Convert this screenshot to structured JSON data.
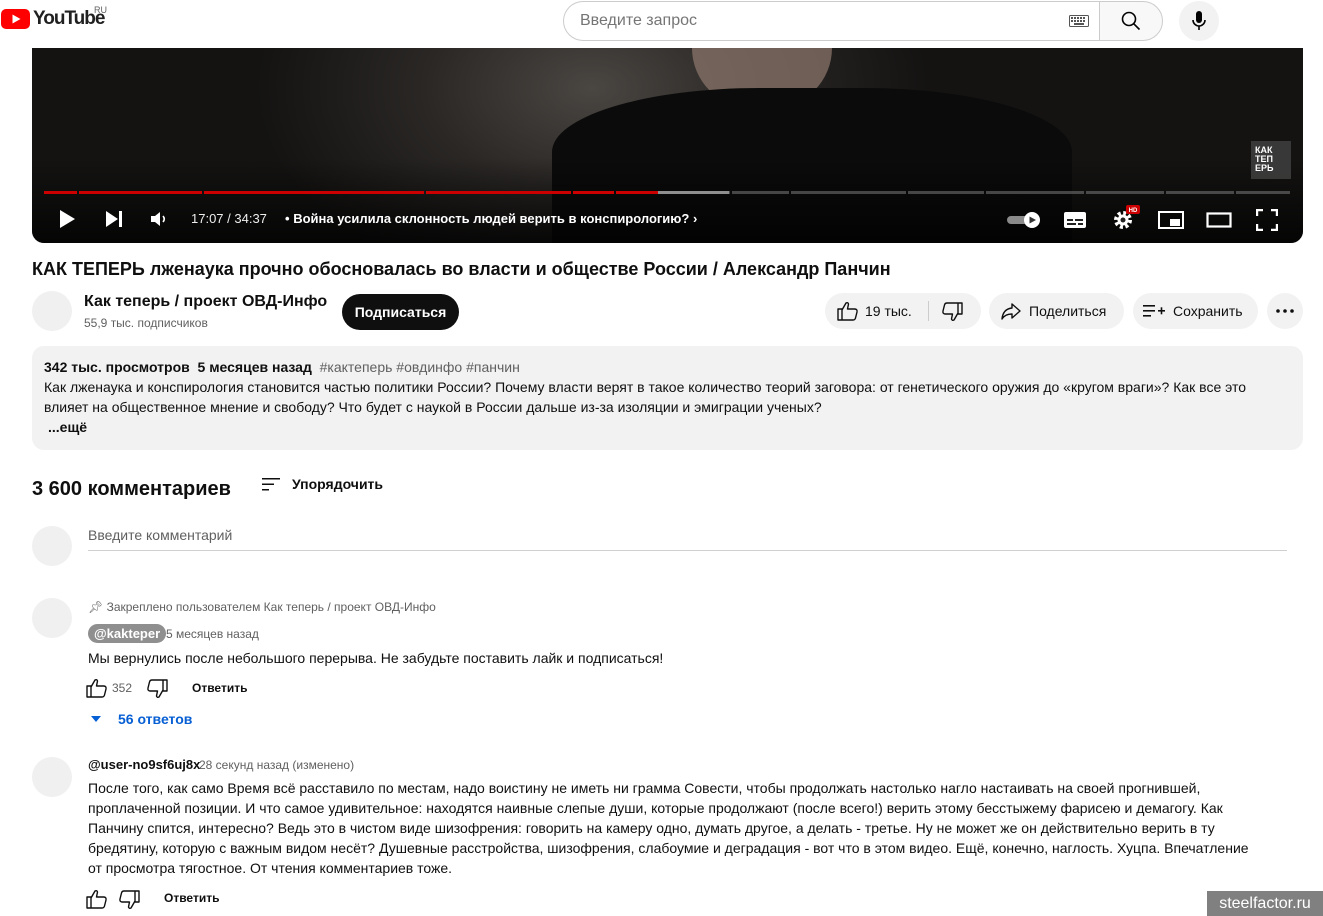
{
  "header": {
    "logo_text": "YouTube",
    "country": "RU",
    "search_placeholder": "Введите запрос"
  },
  "player": {
    "time": "17:07 / 34:37",
    "chapter_separator": "•",
    "chapter": "Война усилила склонность людей верить в конспирологию?",
    "watermark": [
      "КАК",
      "ТЕП",
      "ЕРЬ"
    ],
    "progress_played": 0.493,
    "progress_buffered": 0.55
  },
  "video": {
    "title": "КАК ТЕПЕРЬ лженаука прочно обосновалась во власти и обществе России / Александр Панчин",
    "channel_name": "Как теперь / проект ОВД-Инфо",
    "subscribers": "55,9 тыс. подписчиков",
    "subscribe_label": "Подписаться",
    "likes": "19 тыс.",
    "share_label": "Поделиться",
    "save_label": "Сохранить"
  },
  "description": {
    "views": "342 тыс. просмотров",
    "date": "5 месяцев назад",
    "tags": "#кактеперь #овдинфо #панчин",
    "line1": "Как лженаука и конспирология становится частью политики России? Почему власти верят в такое количество теорий заговора: от генетического оружия до «кругом враги»? Как все это",
    "line2": "влияет на общественное мнение и свободу? Что будет с наукой в России дальше из-за изоляции и эмиграции ученых?",
    "more": "...ещё"
  },
  "comments": {
    "count": "3 600 комментариев",
    "sort_label": "Упорядочить",
    "add_placeholder": "Введите комментарий",
    "reply_label": "Ответить",
    "items": [
      {
        "pinned": "Закреплено пользователем Как теперь / проект ОВД-Инфо",
        "author": "@kakteper",
        "time": "5 месяцев назад",
        "text": "Мы вернулись после небольшого перерыва. Не забудьте поставить лайк и подписаться!",
        "likes": "352",
        "replies": "56 ответов"
      },
      {
        "author": "@user-no9sf6uj8x",
        "time": "28 секунд назад (изменено)",
        "lines": [
          "После того, как само Время всё расставило по местам, надо воистину не иметь ни грамма Совести, чтобы продолжать настолько нагло настаивать на своей прогнившей,",
          "проплаченной позиции. И что самое удивительное: находятся наивные слепые души, которые продолжают (после всего!) верить этому бесстыжему фарисею и демагогу. Как",
          "Панчину спится, интересно? Ведь это в чистом виде шизофрения: говорить на камеру одно, думать другое, а делать - третье. Ну не может же он действительно верить в ту",
          "бредятину, которую с важным видом несёт? Душевные расстройства, шизофрения, слабоумие и деградация - вот что в этом видео. Ещё, конечно, наглость. Хуцпа. Впечатление",
          "от просмотра тягостное. От чтения комментариев тоже."
        ]
      }
    ]
  },
  "site_badge": "steelfactor.ru",
  "colors": {
    "brand_red": "#ff0000",
    "progress_red": "#cc0000",
    "link_blue": "#065fd4"
  }
}
